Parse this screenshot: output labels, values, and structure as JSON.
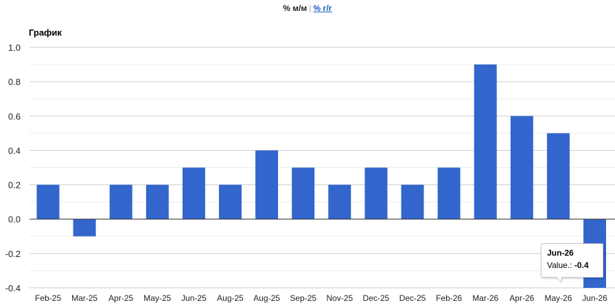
{
  "toggle": {
    "mm_label": "% м/м",
    "separator": "|",
    "yy_label": "% г/г"
  },
  "colors": {
    "bar": "#3366cc",
    "grid": "#cccccc",
    "zero_line": "#333333",
    "link": "#1a5fb4"
  },
  "tooltip": {
    "category": "Jun-26",
    "value_label": "Value.:",
    "value": "-0.4"
  },
  "chart_data": {
    "type": "bar",
    "title": "График",
    "categories": [
      "Feb-25",
      "Mar-25",
      "Apr-25",
      "May-25",
      "Jun-25",
      "Aug-25",
      "Aug-25",
      "Sep-25",
      "Nov-25",
      "Dec-25",
      "Dec-25",
      "Feb-26",
      "Mar-26",
      "Apr-26",
      "May-26",
      "Jun-26"
    ],
    "values": [
      0.2,
      -0.1,
      0.2,
      0.2,
      0.3,
      0.2,
      0.4,
      0.3,
      0.2,
      0.3,
      0.2,
      0.3,
      0.9,
      0.6,
      0.5,
      -0.4
    ],
    "ylim": [
      -0.4,
      1.0
    ],
    "yticks": [
      "1.0",
      "0.8",
      "0.6",
      "0.4",
      "0.2",
      "0.0",
      "-0.2",
      "-0.4"
    ],
    "ytick_values": [
      1.0,
      0.8,
      0.6,
      0.4,
      0.2,
      0.0,
      -0.2,
      -0.4
    ],
    "grid": true,
    "legend": "none",
    "xlabel": "",
    "ylabel": ""
  }
}
